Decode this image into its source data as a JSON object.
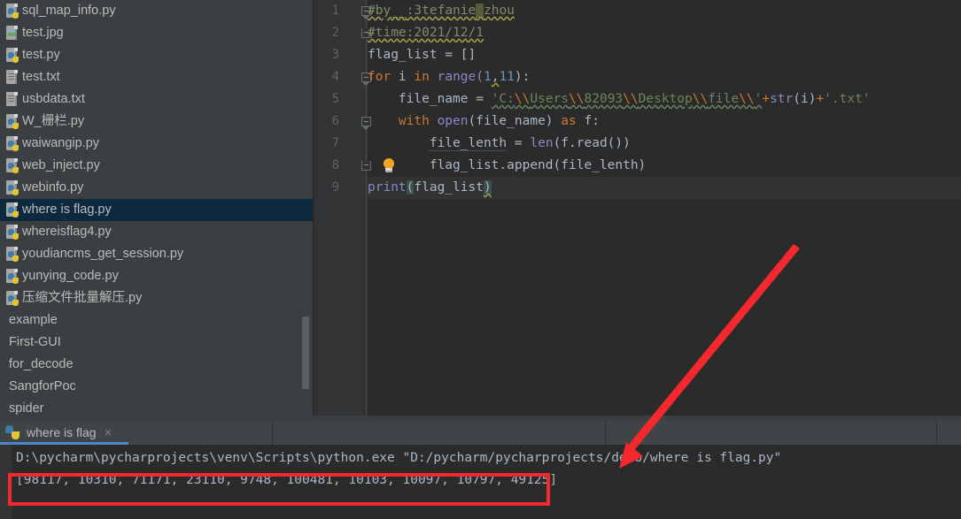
{
  "project_tree": {
    "items": [
      {
        "label": "sql_map_info.py",
        "icon": "python-file-icon",
        "selected": false
      },
      {
        "label": "test.jpg",
        "icon": "image-file-icon",
        "selected": false
      },
      {
        "label": "test.py",
        "icon": "python-file-icon",
        "selected": false
      },
      {
        "label": "test.txt",
        "icon": "text-file-icon",
        "selected": false
      },
      {
        "label": "usbdata.txt",
        "icon": "text-file-icon",
        "selected": false
      },
      {
        "label": "W_栅栏.py",
        "icon": "python-file-icon",
        "selected": false
      },
      {
        "label": "waiwangip.py",
        "icon": "python-file-icon",
        "selected": false
      },
      {
        "label": "web_inject.py",
        "icon": "python-file-icon",
        "selected": false
      },
      {
        "label": "webinfo.py",
        "icon": "python-file-icon",
        "selected": false
      },
      {
        "label": "where is flag.py",
        "icon": "python-file-icon",
        "selected": true
      },
      {
        "label": "whereisflag4.py",
        "icon": "python-file-icon",
        "selected": false
      },
      {
        "label": "youdiancms_get_session.py",
        "icon": "python-file-icon",
        "selected": false
      },
      {
        "label": "yunying_code.py",
        "icon": "python-file-icon",
        "selected": false
      },
      {
        "label": "压缩文件批量解压.py",
        "icon": "python-file-icon",
        "selected": false
      },
      {
        "label": "example",
        "icon": "none",
        "selected": false
      },
      {
        "label": "First-GUI",
        "icon": "none",
        "selected": false
      },
      {
        "label": "for_decode",
        "icon": "none",
        "selected": false
      },
      {
        "label": "SangforPoc",
        "icon": "none",
        "selected": false
      },
      {
        "label": "spider",
        "icon": "none",
        "selected": false
      }
    ]
  },
  "editor": {
    "line_numbers": [
      "1",
      "2",
      "3",
      "4",
      "5",
      "6",
      "7",
      "8",
      "9"
    ],
    "lines": [
      {
        "n": "1",
        "text": "#by__:3tefanie_zhou"
      },
      {
        "n": "2",
        "text": "#time:2021/12/1"
      },
      {
        "n": "3",
        "text": "flag_list = []"
      },
      {
        "n": "4",
        "text": "for i in range(1,11):"
      },
      {
        "n": "5",
        "text": "    file_name = 'C:\\\\Users\\\\82093\\\\Desktop\\\\file\\\\'+str(i)+'.txt'"
      },
      {
        "n": "6",
        "text": "    with open(file_name) as f:"
      },
      {
        "n": "7",
        "text": "        file_lenth = len(f.read())"
      },
      {
        "n": "8",
        "text": "        flag_list.append(file_lenth)"
      },
      {
        "n": "9",
        "text": "print(flag_list)"
      }
    ],
    "tokens": {
      "comment1_a": "#by",
      "comment1_us": "__",
      "comment1_b": ":3tefanie",
      "comment1_sel": "_",
      "comment1_c": "zhou",
      "comment2": "#time:2021/12/1",
      "l3_name": "flag_list",
      "l3_rest": " = []",
      "l4_for": "for",
      "l4_i": " i ",
      "l4_in": "in",
      "l4_range": " range(",
      "l4_one": "1",
      "l4_comma": ",",
      "l4_eleven": "11",
      "l4_end": "):",
      "l5_indent": "    ",
      "l5_name": "file_name",
      "l5_eq": " = ",
      "l5_q1": "'C:",
      "l5_e1": "\\\\",
      "l5_s1": "Users",
      "l5_e2": "\\\\",
      "l5_s2": "82093",
      "l5_e3": "\\\\",
      "l5_s3": "Desktop",
      "l5_e4": "\\\\",
      "l5_s4": "file",
      "l5_e5": "\\\\",
      "l5_q2": "'",
      "l5_plus1": "+",
      "l5_str": "str",
      "l5_i": "(i)",
      "l5_plus2": "+",
      "l5_txt": "'.txt'",
      "l6_indent": "    ",
      "l6_with": "with",
      "l6_open": " open",
      "l6_args": "(file_name) ",
      "l6_as": "as",
      "l6_f": " f:",
      "l7_indent": "        ",
      "l7_name": "file_lenth",
      "l7_eq": " = ",
      "l7_len": "len",
      "l7_rest": "(f.read())",
      "l8_indent": "        ",
      "l8_rest": "flag_list.append(file_lenth)",
      "l9_print": "print",
      "l9_p1": "(",
      "l9_arg": "flag_list",
      "l9_p2": ")"
    }
  },
  "run_window": {
    "tab_label": "where is flag",
    "close_label": "×",
    "console": {
      "command_line": "D:\\pycharm\\pycharprojects\\venv\\Scripts\\python.exe \"D:/pycharm/pycharprojects/demo/where is flag.py\"",
      "output_line": "[98117, 10310, 71171, 23110, 9748, 100481, 10103, 10097, 10797, 49125]"
    }
  },
  "annotations": {
    "highlight_color": "#f5282d",
    "arrow_name": "red-arrow-annotation",
    "box_name": "red-highlight-box"
  }
}
